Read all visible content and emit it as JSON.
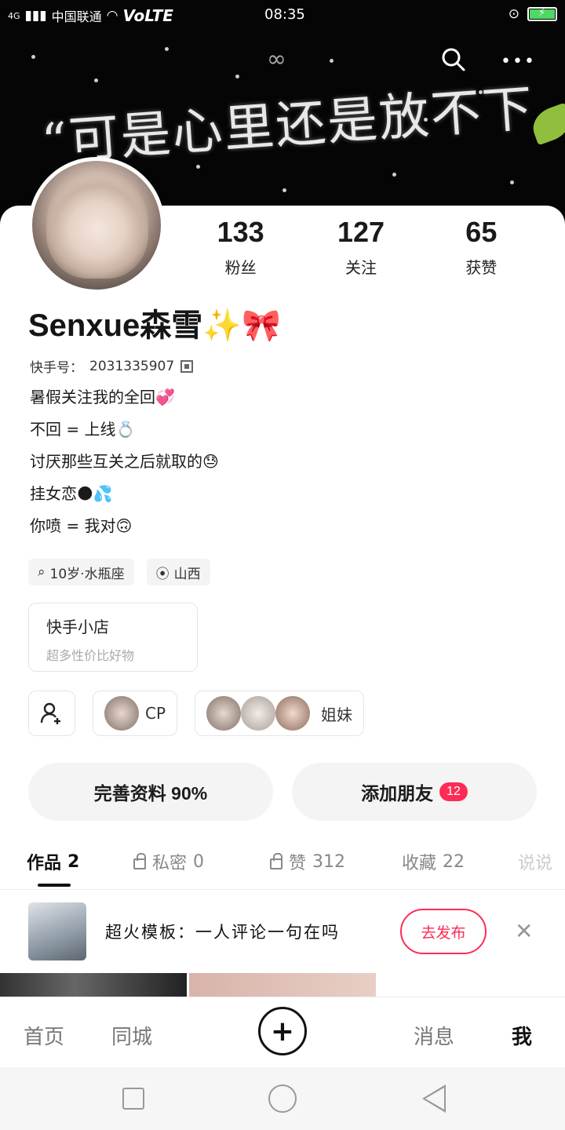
{
  "status_bar": {
    "network": "4G",
    "carrier": "中国联通",
    "volte": "VoLTE",
    "time": "08:35"
  },
  "banner": {
    "text": "“可是心里还是放不下",
    "icons": [
      "infinity-icon",
      "search-icon",
      "more-icon"
    ]
  },
  "profile": {
    "stats": [
      {
        "value": "133",
        "label": "粉丝"
      },
      {
        "value": "127",
        "label": "关注"
      },
      {
        "value": "65",
        "label": "获赞"
      }
    ],
    "name": "Senxue森雪✨🎀",
    "id_label": "快手号：",
    "id_value": "2031335907",
    "bio": [
      {
        "text": "暑假关注我的全回",
        "emoji": "💞"
      },
      {
        "text": "不回 = 上线",
        "emoji": "💍"
      },
      {
        "text": "讨厌那些互关之后就取的",
        "emoji": "😓"
      },
      {
        "text": "挂女恋",
        "emoji": "🌑💦"
      },
      {
        "text": "你喷 = 我对",
        "emoji": "🙃"
      }
    ],
    "tags": [
      "10岁·水瓶座",
      "山西"
    ],
    "shop": {
      "title": "快手小店",
      "subtitle": "超多性价比好物"
    },
    "social": {
      "cp_label": "CP",
      "sisters_label": "姐妹"
    },
    "actions": {
      "complete_profile": "完善资料 90%",
      "add_friends": "添加朋友",
      "add_friends_badge": "12"
    }
  },
  "tabs": [
    {
      "label": "作品",
      "count": "2",
      "locked": false
    },
    {
      "label": "私密",
      "count": "0",
      "locked": true
    },
    {
      "label": "赞",
      "count": "312",
      "locked": true
    },
    {
      "label": "收藏",
      "count": "22",
      "locked": false
    },
    {
      "label": "说说",
      "count": "",
      "locked": false
    }
  ],
  "promo": {
    "text": "超火模板：一人评论一句在吗",
    "button": "去发布"
  },
  "bottom_nav": {
    "home": "首页",
    "city": "同城",
    "messages": "消息",
    "me": "我"
  },
  "colors": {
    "accent": "#fe2c55",
    "battery": "#4cd964"
  }
}
